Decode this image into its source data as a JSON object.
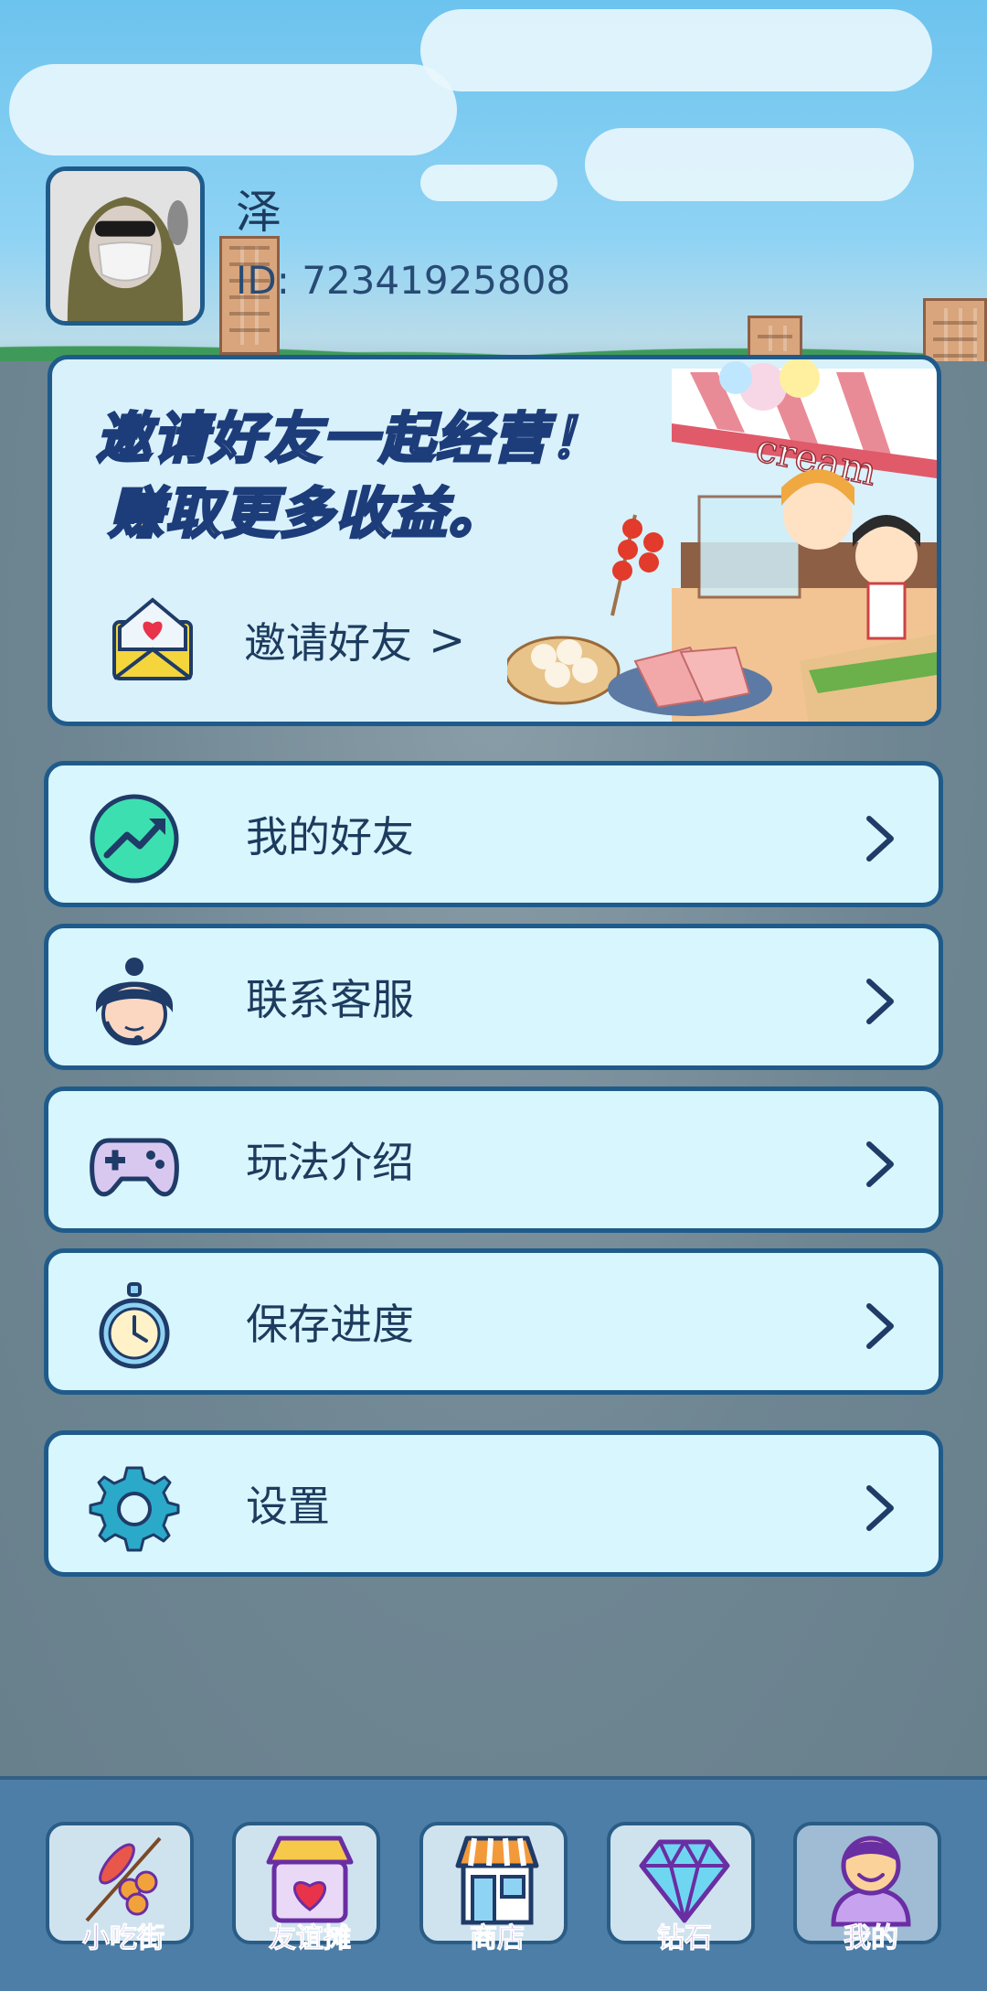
{
  "profile": {
    "name": "泽",
    "id_text": "ID: 72341925808"
  },
  "invite": {
    "title_line1": "邀请好友一起经营！",
    "title_line2": "赚取更多收益。",
    "button_label": "邀请好友",
    "button_chevron": ">",
    "sign_text": "cream"
  },
  "menu": [
    {
      "label": "我的好友",
      "icon": "trend-up-icon"
    },
    {
      "label": "联系客服",
      "icon": "customer-service-icon"
    },
    {
      "label": "玩法介绍",
      "icon": "gamepad-icon"
    },
    {
      "label": "保存进度",
      "icon": "stopwatch-icon"
    },
    {
      "label": "设置",
      "icon": "gear-icon"
    }
  ],
  "nav": [
    {
      "label": "小吃街",
      "icon": "skewer-icon"
    },
    {
      "label": "友谊摊",
      "icon": "heart-shop-icon"
    },
    {
      "label": "商店",
      "icon": "store-icon"
    },
    {
      "label": "钻石",
      "icon": "diamond-icon"
    },
    {
      "label": "我的",
      "icon": "user-icon",
      "active": true
    }
  ],
  "colors": {
    "card_bg": "#d8f6fd",
    "border": "#1f5b8a",
    "text": "#1d3b5e",
    "accent_yellow": "#ffd94a",
    "nav_bg": "#4c7ea7",
    "nav_label": "#6a2ea3"
  }
}
